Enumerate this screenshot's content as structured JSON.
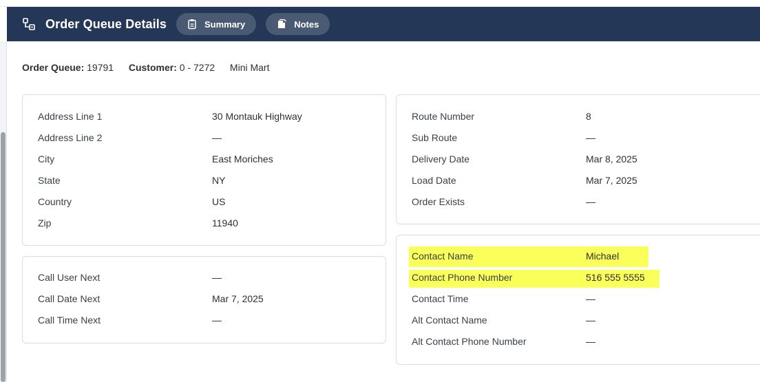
{
  "header": {
    "title": "Order Queue Details",
    "tabs": [
      {
        "label": "Summary",
        "icon": "clipboard-icon"
      },
      {
        "label": "Notes",
        "icon": "notes-icon"
      }
    ],
    "colors": {
      "bar": "#253756",
      "pill": "#4a5a72"
    }
  },
  "info": {
    "order_queue_label": "Order Queue:",
    "order_queue_value": "19791",
    "customer_label": "Customer:",
    "customer_id": "0 - 7272",
    "customer_name": "Mini Mart"
  },
  "address_card": {
    "rows": [
      {
        "label": "Address Line 1",
        "value": "30 Montauk Highway"
      },
      {
        "label": "Address Line 2",
        "value": "—"
      },
      {
        "label": "City",
        "value": "East Moriches"
      },
      {
        "label": "State",
        "value": "NY"
      },
      {
        "label": "Country",
        "value": "US"
      },
      {
        "label": "Zip",
        "value": "11940"
      }
    ]
  },
  "call_card": {
    "rows": [
      {
        "label": "Call User Next",
        "value": "—"
      },
      {
        "label": "Call Date Next",
        "value": "Mar 7, 2025"
      },
      {
        "label": "Call Time Next",
        "value": "—"
      }
    ]
  },
  "route_card": {
    "rows": [
      {
        "label": "Route Number",
        "value": "8"
      },
      {
        "label": "Sub Route",
        "value": "—"
      },
      {
        "label": "Delivery Date",
        "value": "Mar 8, 2025"
      },
      {
        "label": "Load Date",
        "value": "Mar 7, 2025"
      },
      {
        "label": "Order Exists",
        "value": "—"
      }
    ]
  },
  "contact_card": {
    "highlight_color": "#fbff5a",
    "rows": [
      {
        "label": "Contact Name",
        "value": "Michael",
        "highlighted": true
      },
      {
        "label": "Contact Phone Number",
        "value": "516 555 5555",
        "highlighted": true
      },
      {
        "label": "Contact Time",
        "value": "—"
      },
      {
        "label": "Alt Contact Name",
        "value": "—"
      },
      {
        "label": "Alt Contact Phone Number",
        "value": "—"
      }
    ]
  }
}
